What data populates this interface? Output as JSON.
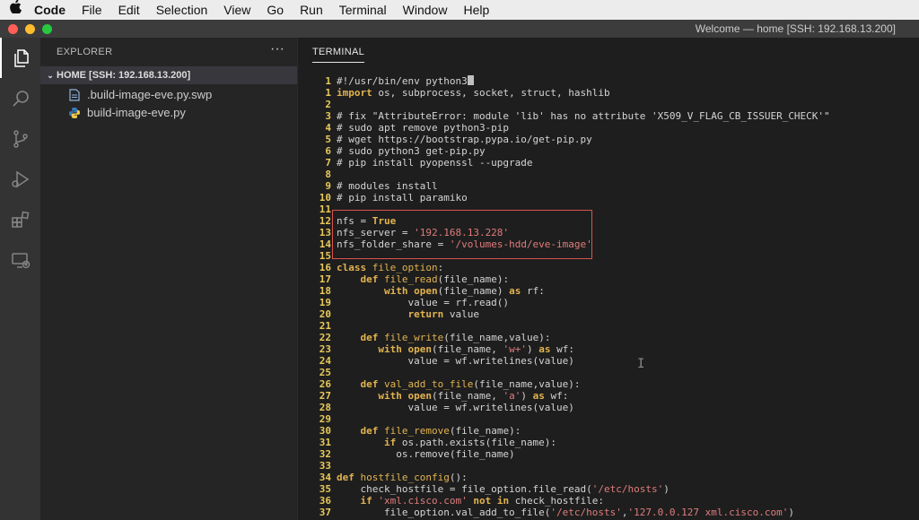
{
  "menubar": {
    "apple": "",
    "items": [
      "Code",
      "File",
      "Edit",
      "Selection",
      "View",
      "Go",
      "Run",
      "Terminal",
      "Window",
      "Help"
    ]
  },
  "window": {
    "title": "Welcome — home [SSH: 192.168.13.200]"
  },
  "activity_bar": {
    "icons": [
      "explorer-icon",
      "search-icon",
      "source-control-icon",
      "run-debug-icon",
      "extensions-icon",
      "remote-explorer-icon"
    ]
  },
  "sidebar": {
    "header": "EXPLORER",
    "more": "···",
    "section_chevron": "⌄",
    "section": "HOME [SSH: 192.168.13.200]",
    "files": [
      {
        "name": ".build-image-eve.py.swp",
        "icon": "file-icon"
      },
      {
        "name": "build-image-eve.py",
        "icon": "python-icon"
      }
    ]
  },
  "panel": {
    "tab": "TERMINAL",
    "lines": [
      {
        "n": "1",
        "text": "#!/usr/bin/env python3"
      },
      {
        "n": "1",
        "text": "import os, subprocess, socket, struct, hashlib"
      },
      {
        "n": "2",
        "text": ""
      },
      {
        "n": "3",
        "text": "# fix \"AttributeError: module 'lib' has no attribute 'X509_V_FLAG_CB_ISSUER_CHECK'\""
      },
      {
        "n": "4",
        "text": "# sudo apt remove python3-pip"
      },
      {
        "n": "5",
        "text": "# wget https://bootstrap.pypa.io/get-pip.py"
      },
      {
        "n": "6",
        "text": "# sudo python3 get-pip.py"
      },
      {
        "n": "7",
        "text": "# pip install pyopenssl --upgrade"
      },
      {
        "n": "8",
        "text": ""
      },
      {
        "n": "9",
        "text": "# modules install"
      },
      {
        "n": "10",
        "text": "# pip install paramiko"
      },
      {
        "n": "11",
        "text": ""
      },
      {
        "n": "12",
        "text": "nfs = True"
      },
      {
        "n": "13",
        "text": "nfs_server = '192.168.13.228'"
      },
      {
        "n": "14",
        "text": "nfs_folder_share = '/volumes-hdd/eve-image'"
      },
      {
        "n": "15",
        "text": ""
      },
      {
        "n": "16",
        "text": "class file_option:"
      },
      {
        "n": "17",
        "text": "    def file_read(file_name):"
      },
      {
        "n": "18",
        "text": "        with open(file_name) as rf:"
      },
      {
        "n": "19",
        "text": "            value = rf.read()"
      },
      {
        "n": "20",
        "text": "            return value"
      },
      {
        "n": "21",
        "text": ""
      },
      {
        "n": "22",
        "text": "    def file_write(file_name,value):"
      },
      {
        "n": "23",
        "text": "       with open(file_name, 'w+') as wf:"
      },
      {
        "n": "24",
        "text": "            value = wf.writelines(value)"
      },
      {
        "n": "25",
        "text": ""
      },
      {
        "n": "26",
        "text": "    def val_add_to_file(file_name,value):"
      },
      {
        "n": "27",
        "text": "       with open(file_name, 'a') as wf:"
      },
      {
        "n": "28",
        "text": "            value = wf.writelines(value)"
      },
      {
        "n": "29",
        "text": ""
      },
      {
        "n": "30",
        "text": "    def file_remove(file_name):"
      },
      {
        "n": "31",
        "text": "        if os.path.exists(file_name):"
      },
      {
        "n": "32",
        "text": "          os.remove(file_name)"
      },
      {
        "n": "33",
        "text": ""
      },
      {
        "n": "34",
        "text": "def hostfile_config():"
      },
      {
        "n": "35",
        "text": "    check_hostfile = file_option.file_read('/etc/hosts')"
      },
      {
        "n": "36",
        "text": "    if 'xml.cisco.com' not in check_hostfile:"
      },
      {
        "n": "37",
        "text": "        file_option.val_add_to_file('/etc/hosts','127.0.0.127 xml.cisco.com')"
      }
    ]
  },
  "colors": {
    "accent_highlight_box": "#d9534f",
    "line_number": "#e8c95a",
    "keyword": "#e2b34f",
    "string": "#e07c7c"
  }
}
